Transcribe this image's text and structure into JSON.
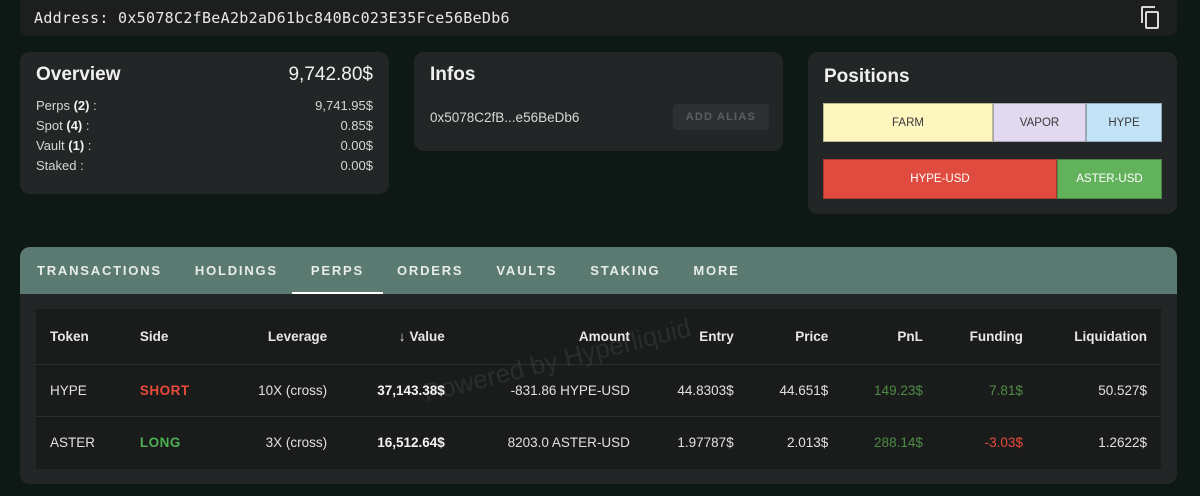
{
  "address_bar": {
    "label": "Address:",
    "address": "0x5078C2fBeA2b2aD61bc840Bc023E35Fce56BeDb6"
  },
  "overview": {
    "title": "Overview",
    "total": "9,742.80$",
    "rows": [
      {
        "label": "Perps",
        "count": "(2)",
        "suffix": " :",
        "value": "9,741.95$"
      },
      {
        "label": "Spot",
        "count": "(4)",
        "suffix": " :",
        "value": "0.85$"
      },
      {
        "label": "Vault",
        "count": "(1)",
        "suffix": " :",
        "value": "0.00$"
      },
      {
        "label": "Staked",
        "count": "",
        "suffix": " :",
        "value": "0.00$"
      }
    ]
  },
  "infos": {
    "title": "Infos",
    "short_address": "0x5078C2fB...e56BeDb6",
    "alias_button": "ADD ALIAS"
  },
  "positions": {
    "title": "Positions",
    "spot_bar": [
      "FARM",
      "VAPOR",
      "HYPE"
    ],
    "perp_bar": [
      "HYPE-USD",
      "ASTER-USD"
    ]
  },
  "tabs": [
    "TRANSACTIONS",
    "HOLDINGS",
    "PERPS",
    "ORDERS",
    "VAULTS",
    "STAKING",
    "MORE"
  ],
  "active_tab": "PERPS",
  "table": {
    "headers": [
      "Token",
      "Side",
      "Leverage",
      "Value",
      "Amount",
      "Entry",
      "Price",
      "PnL",
      "Funding",
      "Liquidation"
    ],
    "rows": [
      [
        "HYPE",
        "SHORT",
        "10X (cross)",
        "37,143.38$",
        "-831.86 HYPE-USD",
        "44.8303$",
        "44.651$",
        "149.23$",
        "7.81$",
        "50.527$"
      ],
      [
        "ASTER",
        "LONG",
        "3X (cross)",
        "16,512.64$",
        "8203.0 ASTER-USD",
        "1.97787$",
        "2.013$",
        "288.14$",
        "-3.03$",
        "1.2622$"
      ]
    ]
  },
  "watermark": "Powered by Hyperliquid",
  "colors": {
    "short": "#e74a3b",
    "long": "#4caf50",
    "tab_bar": "#5b7a72",
    "farm": "#fdf6bf",
    "vapor": "#e0d9ef",
    "hype": "#c2e2f6",
    "hype_usd": "#df4c3f",
    "aster_usd": "#62b25b"
  }
}
